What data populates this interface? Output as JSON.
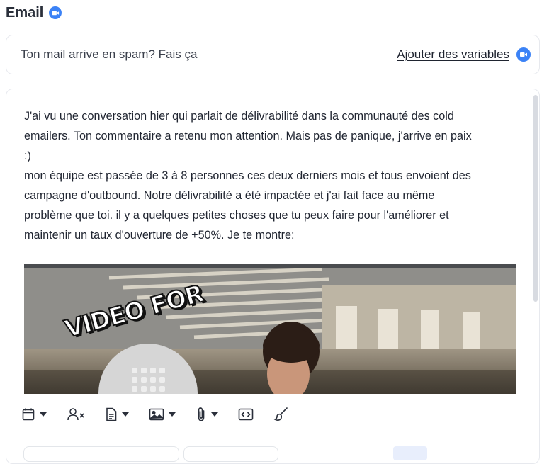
{
  "header": {
    "title": "Email",
    "title_icon": "video-camera-icon",
    "accent": "#3b82f6"
  },
  "subject": {
    "text": "Ton mail arrive en spam? Fais ça",
    "variables_link": "Ajouter des variables",
    "variables_icon": "video-camera-icon"
  },
  "body": {
    "paragraph": "J'ai vu une conversation hier qui parlait de délivrabilité dans la communauté des cold\nemailers. Ton commentaire a retenu mon attention. Mais pas de panique, j'arrive en paix\n:)\nmon équipe est passée de 3 à 8 personnes ces deux derniers mois et tous envoient des\ncampagne d'outbound. Notre délivrabilité a été impactée et j'ai fait face au même\nproblème que toi. il y a quelques petites choses que tu peux faire pour l'améliorer et\nmaintenir un taux d'ouverture de +50%. Je te montre:",
    "video": {
      "caption": "VIDEO FOR",
      "thumbnail_icon": "building-avatar-icon"
    }
  },
  "toolbar": {
    "tools": [
      {
        "name": "calendar-icon",
        "dropdown": true
      },
      {
        "name": "remove-user-icon",
        "dropdown": false
      },
      {
        "name": "document-icon",
        "dropdown": true
      },
      {
        "name": "image-icon",
        "dropdown": true
      },
      {
        "name": "attachment-icon",
        "dropdown": true
      },
      {
        "name": "code-icon",
        "dropdown": false
      },
      {
        "name": "brush-icon",
        "dropdown": false
      }
    ]
  }
}
